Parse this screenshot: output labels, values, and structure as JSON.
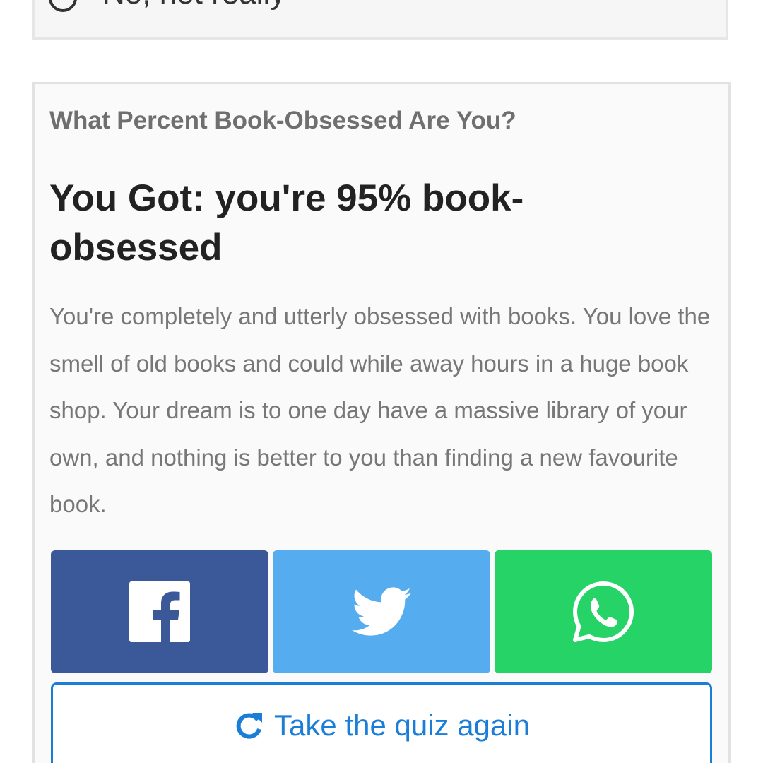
{
  "previous_question": {
    "option_label": "No, not really"
  },
  "result": {
    "quiz_title": "What Percent Book-Obsessed Are You?",
    "heading": "You Got: you're 95% book-obsessed",
    "description": "You're completely and utterly obsessed with books. You love the smell of old books and could while away hours in a huge book shop. Your dream is to one day have a massive library of your own, and nothing is better to you than finding a new favourite book."
  },
  "share": {
    "buttons": [
      {
        "network": "facebook",
        "icon": "facebook-icon",
        "color": "#3b5998"
      },
      {
        "network": "twitter",
        "icon": "twitter-bird-icon",
        "color": "#55acee"
      },
      {
        "network": "whatsapp",
        "icon": "whatsapp-icon",
        "color": "#25d366"
      }
    ]
  },
  "retake": {
    "label": "Take the quiz again",
    "icon": "refresh-icon",
    "color": "#1a7ed8"
  }
}
